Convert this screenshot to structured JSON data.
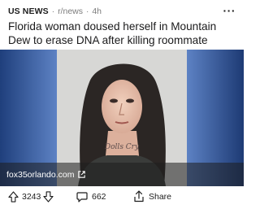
{
  "post": {
    "subreddit_label": "US NEWS",
    "separator": "·",
    "subreddit_link": "r/news",
    "age": "4h",
    "more_glyph": "···",
    "title": "Florida woman doused herself in Mountain Dew to erase DNA after killing roommate",
    "image_alt": "mugshot-photo",
    "tattoo_text": "Dolls Cry",
    "domain": "fox35orlando.com"
  },
  "actions": {
    "score": "3243",
    "comments": "662",
    "share_label": "Share"
  },
  "colors": {
    "background_blue": "#2a4f91",
    "text": "#1a1a1b",
    "muted": "#7c7c7c"
  }
}
